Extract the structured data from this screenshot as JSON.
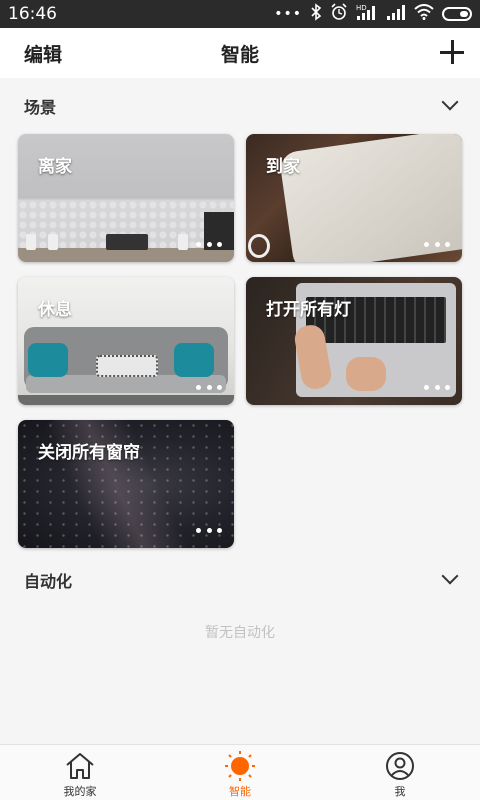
{
  "status_bar": {
    "time": "16:46",
    "icons": [
      "more-dots-icon",
      "bluetooth-icon",
      "alarm-icon",
      "hd-signal-icon",
      "signal-icon",
      "wifi-icon",
      "battery-icon"
    ],
    "hd": "HD"
  },
  "header": {
    "edit_label": "编辑",
    "title": "智能"
  },
  "scenes_section": {
    "label": "场景",
    "cards": [
      {
        "label": "离家"
      },
      {
        "label": "到家"
      },
      {
        "label": "休息"
      },
      {
        "label": "打开所有灯"
      },
      {
        "label": "关闭所有窗帘"
      }
    ]
  },
  "automation_section": {
    "label": "自动化",
    "empty_text": "暂无自动化"
  },
  "bottom_nav": {
    "active_color": "#ff6600",
    "tabs": [
      {
        "label": "我的家",
        "icon": "home-icon"
      },
      {
        "label": "智能",
        "icon": "sun-icon"
      },
      {
        "label": "我",
        "icon": "profile-icon"
      }
    ]
  }
}
